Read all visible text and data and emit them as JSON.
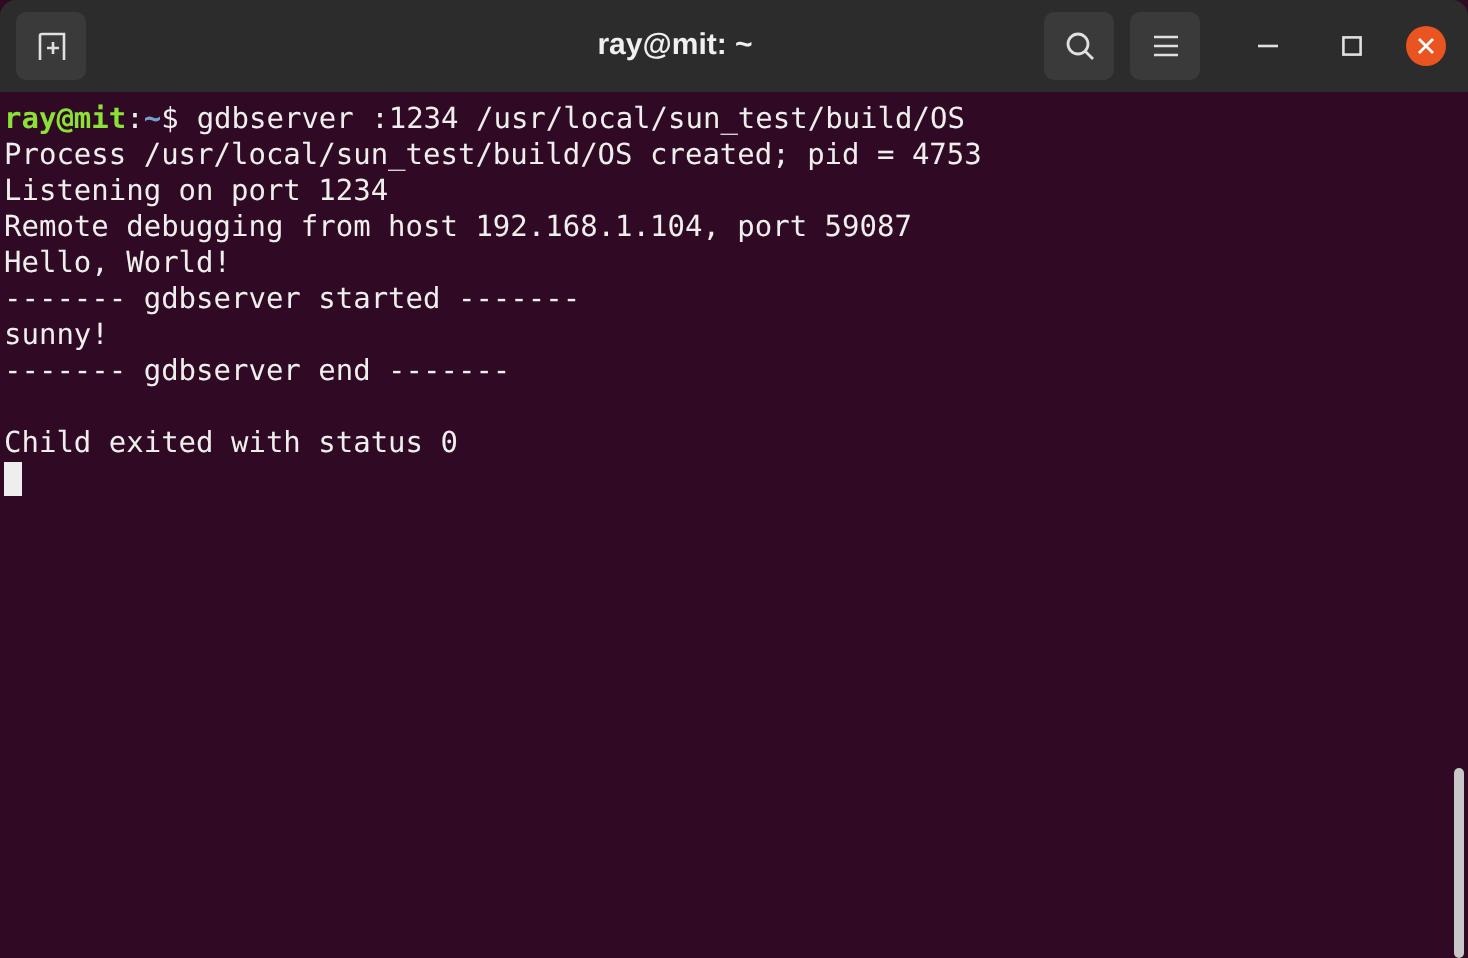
{
  "window": {
    "title": "ray@mit: ~"
  },
  "prompt": {
    "user_host": "ray@mit",
    "separator": ":",
    "path": "~",
    "symbol": "$",
    "command": "gdbserver :1234 /usr/local/sun_test/build/OS"
  },
  "output": [
    "Process /usr/local/sun_test/build/OS created; pid = 4753",
    "Listening on port 1234",
    "Remote debugging from host 192.168.1.104, port 59087",
    "Hello, World!",
    "------- gdbserver started -------",
    "sunny!",
    "------- gdbserver end -------"
  ],
  "exit_message": "Child exited with status 0",
  "cursor": {
    "visible": true
  }
}
